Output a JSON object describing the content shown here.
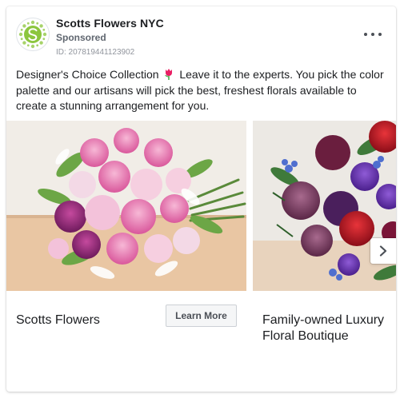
{
  "post": {
    "page_name": "Scotts Flowers NYC",
    "sponsored_label": "Sponsored",
    "ad_id": "ID: 207819441123902",
    "body_text_before_emoji": "Designer's Choice Collection",
    "body_text_after_emoji": " Leave it to the experts. You pick the color palette and our artisans will pick the best, freshest florals available to create a stunning arrangement for you.",
    "emoji": "tulip"
  },
  "carousel": {
    "cards": [
      {
        "headline": "Scotts Flowers",
        "cta_label": "Learn More",
        "image": "pink-bouquet"
      },
      {
        "headline": "Family-owned Luxury Floral Boutique",
        "image": "red-purple-bouquet"
      }
    ]
  },
  "colors": {
    "brand_green": "#8cc63e",
    "text_primary": "#1c1e21",
    "text_secondary": "#606770",
    "button_bg": "#f5f6f7"
  }
}
